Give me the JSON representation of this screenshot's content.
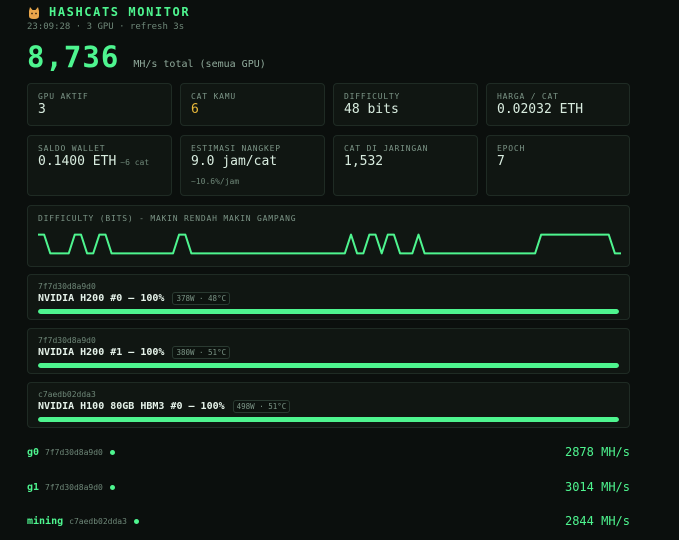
{
  "header": {
    "title": "HASHCATS MONITOR",
    "subtitle": "23:09:28 · 3 GPU · refresh 3s",
    "icon": "cat-icon"
  },
  "total": {
    "value": "8,736",
    "label": "MH/s total (semua GPU)"
  },
  "stats": [
    {
      "label": "GPU AKTIF",
      "value": "3"
    },
    {
      "label": "CAT KAMU",
      "value": "6"
    },
    {
      "label": "DIFFICULTY",
      "value": "48 bits"
    },
    {
      "label": "HARGA / CAT",
      "value": "0.02032 ETH"
    },
    {
      "label": "SALDO WALLET",
      "value": "0.1400 ETH",
      "extra": "~6 cat"
    },
    {
      "label": "ESTIMASI NANGKEP",
      "value": "9.0 jam/cat",
      "note": "~10.6%/jam"
    },
    {
      "label": "CAT DI JARINGAN",
      "value": "1,532"
    },
    {
      "label": "EPOCH",
      "value": "7"
    }
  ],
  "colors": {
    "accent": "#4ef58f",
    "highlight": "#e9b93a",
    "background": "#0b0f0d",
    "card": "#101612"
  },
  "chart_data": {
    "type": "line",
    "title": "DIFFICULTY (BITS) - MAKIN RENDAH MAKIN GAMPANG",
    "series": [
      {
        "values": [
          49,
          49,
          48,
          48,
          48,
          48,
          49,
          49,
          48,
          48,
          49,
          49,
          48,
          48,
          48,
          48,
          48,
          48,
          48,
          48,
          48,
          48,
          48,
          49,
          49,
          48,
          48,
          48,
          48,
          48,
          48,
          48,
          48,
          48,
          48,
          48,
          48,
          48,
          48,
          48,
          48,
          48,
          48,
          48,
          48,
          48,
          48,
          48,
          48,
          48,
          48,
          49,
          48,
          48,
          49,
          49,
          48,
          49,
          49,
          48,
          48,
          48,
          49,
          48,
          48,
          48,
          48,
          48,
          48,
          48,
          48,
          48,
          48,
          48,
          48,
          48,
          48,
          48,
          48,
          48,
          48,
          48,
          49,
          49,
          49,
          49,
          49,
          49,
          49,
          49,
          49,
          49,
          49,
          49,
          48,
          48
        ]
      }
    ],
    "ylim": [
      47.7,
      49.3
    ],
    "grid": false
  },
  "gpus": [
    {
      "id": "7f7d30d8a9d0",
      "name": "NVIDIA H200 #0 — 100%",
      "stats": "378W · 48°C",
      "util": 100
    },
    {
      "id": "7f7d30d8a9d0",
      "name": "NVIDIA H200 #1 — 100%",
      "stats": "380W · 51°C",
      "util": 100
    },
    {
      "id": "c7aedb02dda3",
      "name": "NVIDIA H100 80GB HBM3 #0 — 100%",
      "stats": "498W · 51°C",
      "util": 100
    }
  ],
  "workers": [
    {
      "name": "g0",
      "id": "7f7d30d8a9d0",
      "rate": "2878 MH/s"
    },
    {
      "name": "g1",
      "id": "7f7d30d8a9d0",
      "rate": "3014 MH/s"
    },
    {
      "name": "mining",
      "id": "c7aedb02dda3",
      "rate": "2844 MH/s"
    }
  ]
}
